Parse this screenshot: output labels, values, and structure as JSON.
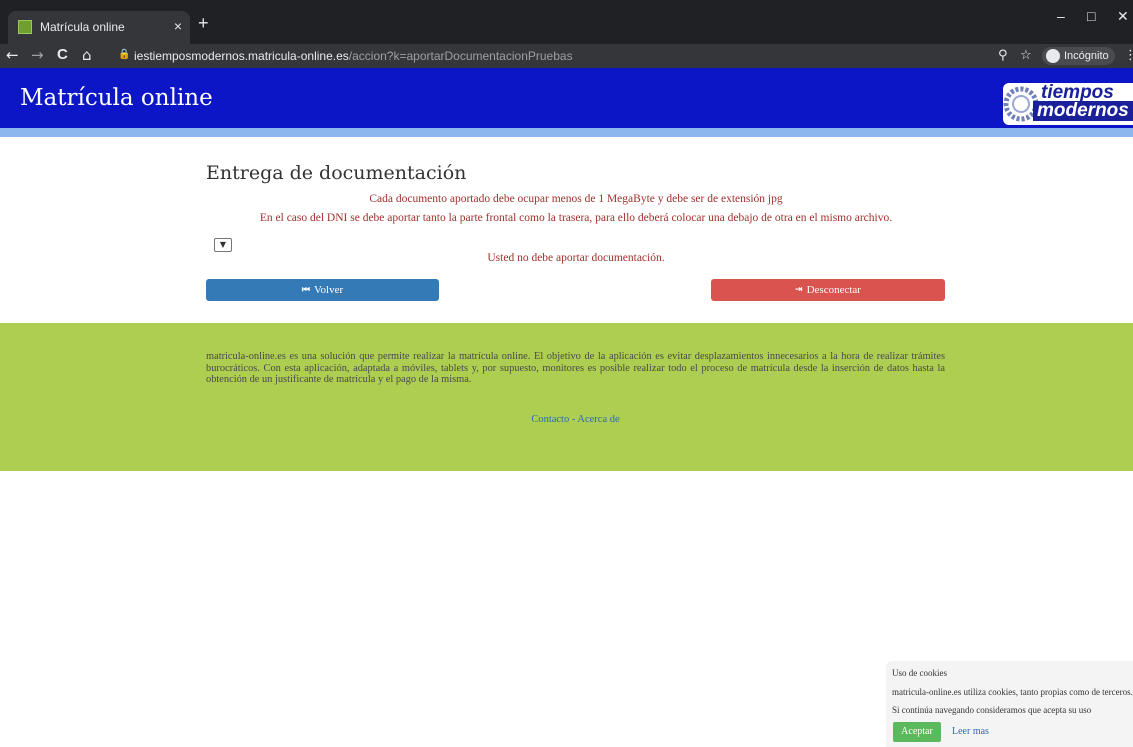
{
  "browser": {
    "tab_title": "Matrícula online",
    "tab_close": "×",
    "new_tab": "+",
    "url_host": "iestiemposmodernos.matricula-online.es",
    "url_path": "/accion?k=aportarDocumentacionPruebas",
    "incognito_label": "Incógnito",
    "nav": {
      "back": "←",
      "forward": "→",
      "reload": "C",
      "home": "⌂"
    },
    "window": {
      "minimize": "–",
      "maximize": "□",
      "close": "✕"
    }
  },
  "header": {
    "title": "Matrícula online",
    "logo_line1": "tiempos",
    "logo_line2": "modernos"
  },
  "main": {
    "title": "Entrega de documentación",
    "note1": "Cada documento aportado debe ocupar menos de 1 MegaByte y debe ser de extensión jpg",
    "note2": "En el caso del DNI se debe aportar tanto la parte frontal como la trasera, para ello deberá colocar una debajo de otra en el mismo archivo.",
    "status": "Usted no debe aportar documentación.",
    "volver_label": "Volver",
    "desconectar_label": "Desconectar"
  },
  "footer": {
    "text": "matricula-online.es es una solución que permite realizar la matrícula online. El objetivo de la aplicación es evitar desplazamientos innecesarios a la hora de realizar trámites burocráticos. Con esta aplicación, adaptada a móviles, tablets y, por supuesto, monitores es posible realizar todo el proceso de matrícula desde la inserción de datos hasta la obtención de un justificante de matrícula y el pago de la misma.",
    "contacto": "Contacto",
    "separator": " - ",
    "acerca": "Acerca de"
  },
  "cookies": {
    "title": "Uso de cookies",
    "line1": "matricula-online.es utiliza cookies, tanto propias como de terceros.",
    "line2": "Si continúa navegando consideramos que acepta su uso",
    "accept_label": "Aceptar",
    "more_label": "Leer mas"
  },
  "colors": {
    "header_blue": "#0c16c6",
    "strip_blue": "#8cb6ee",
    "footer_green": "#aece52",
    "volver_blue": "#337ab7",
    "desconectar_red": "#d9534f",
    "accept_green": "#5cb85c",
    "note_red": "#a0322d"
  },
  "icons": {
    "volver": "step-backward-icon",
    "desconectar": "log-out-icon",
    "select": "chevron-down-icon"
  }
}
